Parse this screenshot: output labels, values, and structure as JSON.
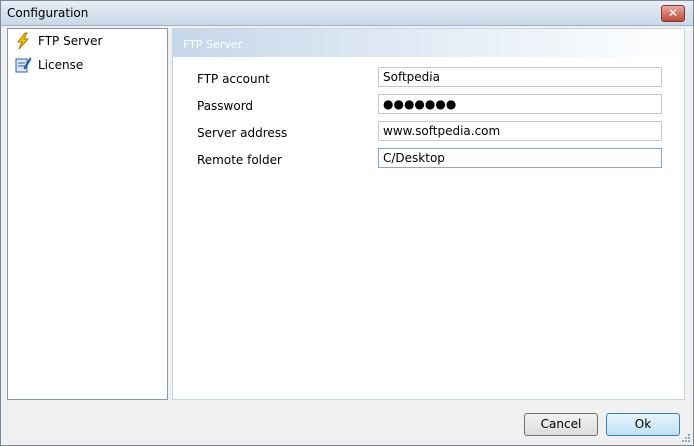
{
  "window": {
    "title": "Configuration"
  },
  "sidebar": {
    "items": [
      {
        "label": "FTP Server",
        "icon": "lightning-icon"
      },
      {
        "label": "License",
        "icon": "license-document-icon"
      }
    ]
  },
  "panel": {
    "title": "FTP Server"
  },
  "fields": [
    {
      "label": "FTP account",
      "value": "Softpedia"
    },
    {
      "label": "Password",
      "value": "●●●●●●●"
    },
    {
      "label": "Server address",
      "value": "www.softpedia.com"
    },
    {
      "label": "Remote folder",
      "value": "C/Desktop"
    }
  ],
  "buttons": {
    "cancel": "Cancel",
    "ok": "Ok"
  },
  "colors": {
    "accent": "#3c7fb1",
    "header": "#c6d7ea"
  }
}
